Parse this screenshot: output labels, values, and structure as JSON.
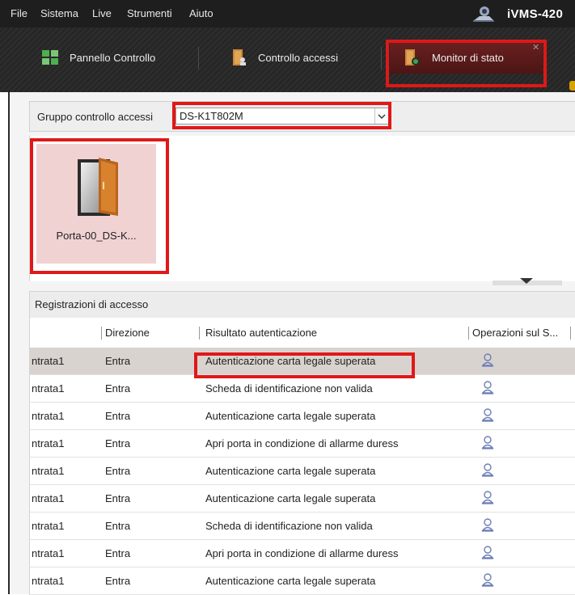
{
  "menubar": {
    "items": [
      "File",
      "Sistema",
      "Live",
      "Strumenti",
      "Aiuto"
    ],
    "brand": "iVMS-420"
  },
  "tabs": [
    {
      "label": "Pannello Controllo",
      "icon": "grid-icon"
    },
    {
      "label": "Controllo accessi",
      "icon": "door-user-icon"
    },
    {
      "label": "Monitor di stato",
      "icon": "door-status-icon",
      "active": true
    }
  ],
  "group": {
    "label": "Gruppo controllo accessi",
    "selected": "DS-K1T802M"
  },
  "door": {
    "name": "Porta-00_DS-K..."
  },
  "records": {
    "title": "Registrazioni di accesso",
    "columns": [
      "Direzione",
      "Risultato autenticazione",
      "Operazioni sul S..."
    ],
    "rows": [
      {
        "name": "ntrata1",
        "direction": "Entra",
        "result": "Autenticazione carta legale superata",
        "selected": true
      },
      {
        "name": "ntrata1",
        "direction": "Entra",
        "result": "Scheda di identificazione non valida"
      },
      {
        "name": "ntrata1",
        "direction": "Entra",
        "result": "Autenticazione carta legale superata"
      },
      {
        "name": "ntrata1",
        "direction": "Entra",
        "result": "Apri porta in condizione di allarme duress"
      },
      {
        "name": "ntrata1",
        "direction": "Entra",
        "result": "Autenticazione carta legale superata"
      },
      {
        "name": "ntrata1",
        "direction": "Entra",
        "result": "Autenticazione carta legale superata"
      },
      {
        "name": "ntrata1",
        "direction": "Entra",
        "result": "Scheda di identificazione non valida"
      },
      {
        "name": "ntrata1",
        "direction": "Entra",
        "result": "Apri porta in condizione di allarme duress"
      },
      {
        "name": "ntrata1",
        "direction": "Entra",
        "result": "Autenticazione carta legale superata"
      }
    ]
  },
  "colors": {
    "highlight": "#e01818",
    "active_tab": "#5a1a1a",
    "door_tile": "#f1d2d2",
    "selected_row": "#d9d3cf"
  }
}
